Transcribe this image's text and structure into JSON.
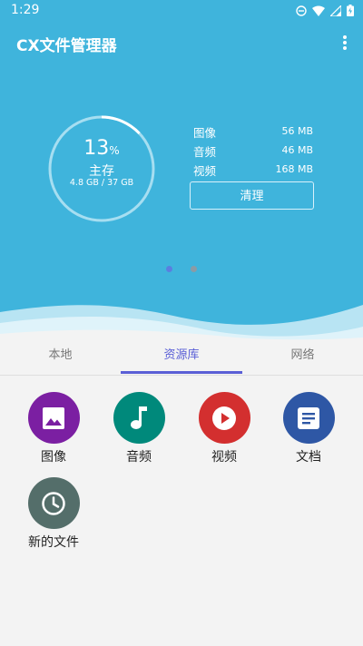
{
  "status_bar": {
    "time": "1:29"
  },
  "app": {
    "title": "CX文件管理器",
    "more_icon": "more-vert-icon"
  },
  "storage": {
    "percent": "13",
    "percent_sign": "%",
    "label": "主存",
    "size_text": "4.8 GB / 37 GB",
    "used_fraction": 0.13
  },
  "stats": [
    {
      "name": "图像",
      "value": "56 MB"
    },
    {
      "name": "音频",
      "value": "46 MB"
    },
    {
      "name": "视频",
      "value": "168 MB"
    }
  ],
  "clean_button": "清理",
  "pager": {
    "pages": 2,
    "active": 0
  },
  "tabs": [
    {
      "label": "本地"
    },
    {
      "label": "资源库"
    },
    {
      "label": "网络"
    }
  ],
  "active_tab": 1,
  "library": [
    {
      "label": "图像",
      "icon": "image-icon",
      "color": "#7b1fa2"
    },
    {
      "label": "音频",
      "icon": "music-note-icon",
      "color": "#00897b"
    },
    {
      "label": "视频",
      "icon": "play-icon",
      "color": "#d32f2f"
    },
    {
      "label": "文档",
      "icon": "document-icon",
      "color": "#2e57a5"
    },
    {
      "label": "新的文件",
      "icon": "clock-icon",
      "color": "#546e6a"
    }
  ],
  "colors": {
    "header": "#3fb4dc",
    "accent": "#5a5fd6",
    "background": "#f3f3f3"
  }
}
